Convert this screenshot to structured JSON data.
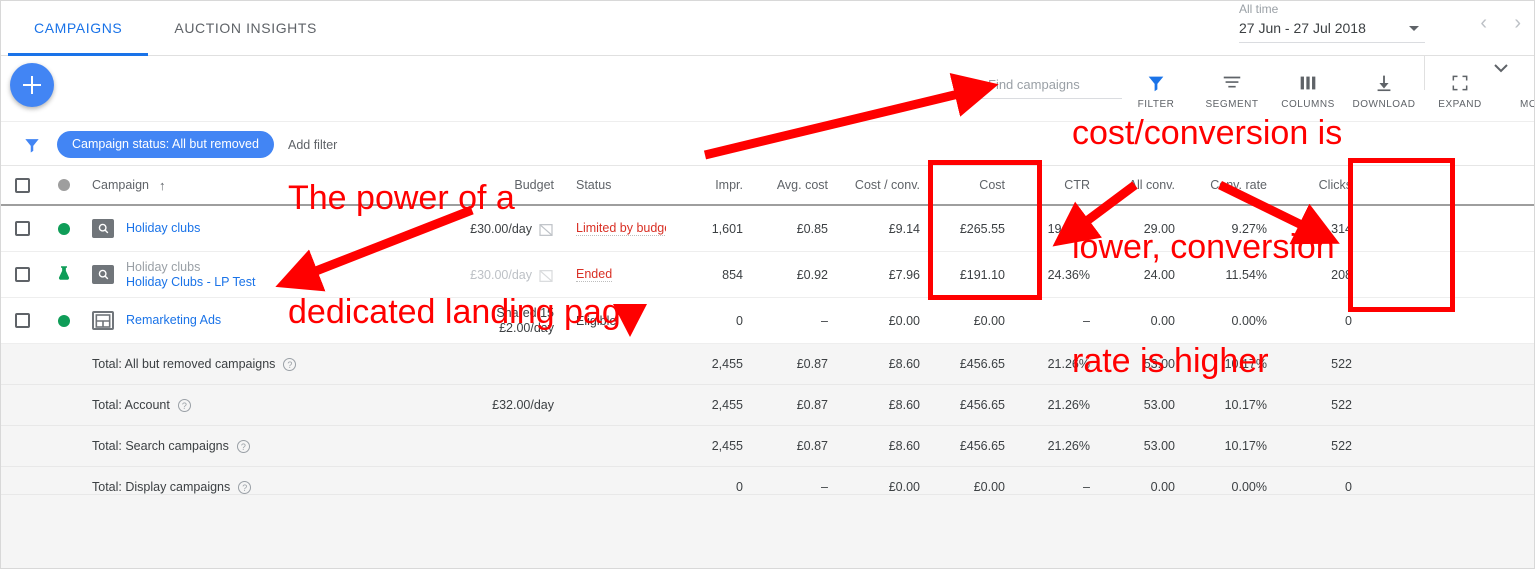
{
  "tabs": [
    {
      "label": "CAMPAIGNS",
      "active": true
    },
    {
      "label": "AUCTION INSIGHTS",
      "active": false
    }
  ],
  "date_range": {
    "label": "All time",
    "value": "27 Jun - 27 Jul 2018"
  },
  "search": {
    "placeholder": "Find campaigns",
    "value": ""
  },
  "toolbar": {
    "actions": [
      {
        "label": "FILTER",
        "icon": "filter-icon"
      },
      {
        "label": "SEGMENT",
        "icon": "segment-icon"
      },
      {
        "label": "COLUMNS",
        "icon": "columns-icon"
      },
      {
        "label": "DOWNLOAD",
        "icon": "download-icon"
      },
      {
        "label": "EXPAND",
        "icon": "expand-icon"
      },
      {
        "label": "MORE",
        "icon": "more-vert-icon"
      }
    ]
  },
  "filters": {
    "chip": "Campaign status: All but removed",
    "add_filter": "Add filter"
  },
  "table": {
    "headers": {
      "campaign": "Campaign",
      "budget": "Budget",
      "status": "Status",
      "impr": "Impr.",
      "avg_cost": "Avg. cost",
      "cost_conv": "Cost / conv.",
      "cost": "Cost",
      "ctr": "CTR",
      "all_conv": "All conv.",
      "conv_rate": "Conv. rate",
      "clicks": "Clicks"
    },
    "rows": [
      {
        "status_dot": "green",
        "type_icon": "search-campaign-icon",
        "name_sub": "",
        "name": "Holiday clubs",
        "budget": "£30.00/day",
        "budget_muted": false,
        "status": "Limited by budget",
        "status_color": "red",
        "has_chart_icon": true,
        "impr": "1,601",
        "avg_cost": "£0.85",
        "cost_conv": "£9.14",
        "cost": "£265.55",
        "ctr": "19.61%",
        "all_conv": "29.00",
        "conv_rate": "9.27%",
        "clicks": "314"
      },
      {
        "status_dot": "experiment",
        "type_icon": "search-campaign-icon",
        "name_sub": "Holiday clubs",
        "name": "Holiday Clubs - LP Test",
        "budget": "£30.00/day",
        "budget_muted": true,
        "status": "Ended",
        "status_color": "red",
        "has_chart_icon": false,
        "impr": "854",
        "avg_cost": "£0.92",
        "cost_conv": "£7.96",
        "cost": "£191.10",
        "ctr": "24.36%",
        "all_conv": "24.00",
        "conv_rate": "11.54%",
        "clicks": "208"
      },
      {
        "status_dot": "green",
        "type_icon": "display-campaign-icon",
        "name_sub": "Shared 15",
        "name": "Remarketing Ads",
        "budget_line1": "Shared 15",
        "budget": "£2.00/day",
        "budget_muted": false,
        "status": "Eligible",
        "status_color": "grey",
        "has_chart_icon": false,
        "impr": "0",
        "avg_cost": "–",
        "cost_conv": "£0.00",
        "cost": "£0.00",
        "ctr": "–",
        "all_conv": "0.00",
        "conv_rate": "0.00%",
        "clicks": "0"
      }
    ],
    "totals": [
      {
        "label": "Total: All but removed campaigns",
        "budget": "",
        "impr": "2,455",
        "avg_cost": "£0.87",
        "cost_conv": "£8.60",
        "cost": "£456.65",
        "ctr": "21.26%",
        "all_conv": "53.00",
        "conv_rate": "10.17%",
        "clicks": "522"
      },
      {
        "label": "Total: Account",
        "budget": "£32.00/day",
        "impr": "2,455",
        "avg_cost": "£0.87",
        "cost_conv": "£8.60",
        "cost": "£456.65",
        "ctr": "21.26%",
        "all_conv": "53.00",
        "conv_rate": "10.17%",
        "clicks": "522"
      },
      {
        "label": "Total: Search campaigns",
        "budget": "",
        "impr": "2,455",
        "avg_cost": "£0.87",
        "cost_conv": "£8.60",
        "cost": "£456.65",
        "ctr": "21.26%",
        "all_conv": "53.00",
        "conv_rate": "10.17%",
        "clicks": "522"
      },
      {
        "label": "Total: Display campaigns",
        "budget": "",
        "impr": "0",
        "avg_cost": "–",
        "cost_conv": "£0.00",
        "cost": "£0.00",
        "ctr": "–",
        "all_conv": "0.00",
        "conv_rate": "0.00%",
        "clicks": "0"
      }
    ]
  },
  "annotations": {
    "color": "#ff0000",
    "note_left_line1": "The power of a",
    "note_left_line2": "dedicated landing page",
    "note_right_line1": "cost/conversion is",
    "note_right_line2": "lower, conversion",
    "note_right_line3": "rate is higher"
  }
}
